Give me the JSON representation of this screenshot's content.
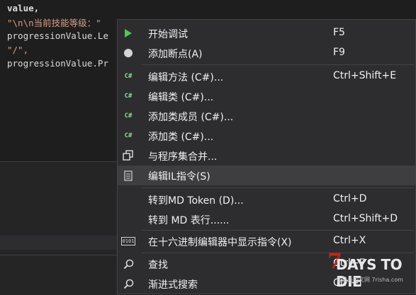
{
  "editor": {
    "lines": [
      "value,",
      "\"\\n\\n当前技能等级：\"",
      "progressionValue.Le",
      "\"/\",",
      "progressionValue.Pr"
    ]
  },
  "menu": {
    "items": [
      {
        "label": "开始调试",
        "shortcut": "F5",
        "icon": "play-icon"
      },
      {
        "label": "添加断点(A)",
        "shortcut": "F9",
        "icon": "breakpoint-icon"
      },
      {
        "label": "编辑方法 (C#)...",
        "shortcut": "Ctrl+Shift+E",
        "icon": "csharp-icon"
      },
      {
        "label": "编辑类 (C#)...",
        "shortcut": "",
        "icon": "csharp-icon"
      },
      {
        "label": "添加类成员 (C#)...",
        "shortcut": "",
        "icon": "csharp-icon"
      },
      {
        "label": "添加类 (C#)...",
        "shortcut": "",
        "icon": "csharp-icon"
      },
      {
        "label": "与程序集合并...",
        "shortcut": "",
        "icon": "merge-icon"
      },
      {
        "label": "编辑IL指令(S)",
        "shortcut": "",
        "icon": "document-icon"
      },
      {
        "label": "转到MD Token (D)...",
        "shortcut": "Ctrl+D",
        "icon": ""
      },
      {
        "label": "转到 MD 表行......",
        "shortcut": "Ctrl+Shift+D",
        "icon": ""
      },
      {
        "label": "在十六进制编辑器中显示指令(X)",
        "shortcut": "Ctrl+X",
        "icon": "hex-icon"
      },
      {
        "label": "查找",
        "shortcut": "Ctrl+F",
        "icon": "search-icon"
      },
      {
        "label": "渐进式搜索",
        "shortcut": "Ctrl+I",
        "icon": "search-icon"
      }
    ],
    "icon_texts": {
      "csharp": "C#",
      "hex": "0101"
    }
  },
  "watermark": {
    "seven": "7",
    "title": "DAYS TO DIE",
    "subtitle": "七日杀中文网 7risha.com"
  },
  "colors": {
    "menu_bg": "#2d2d30",
    "highlight": "#3e3e40",
    "play_green": "#4ec94e",
    "csharp_green": "#8ddb8c",
    "string_color": "#d69d85"
  }
}
